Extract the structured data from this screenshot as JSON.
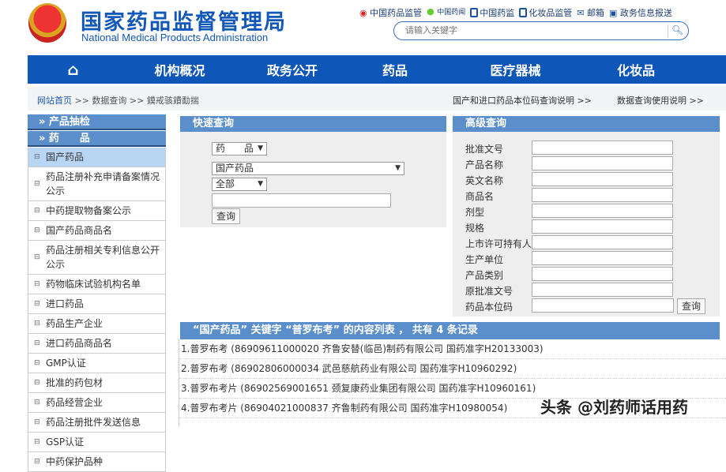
{
  "header": {
    "title_cn": "国家药品监督管理局",
    "title_en": "National Medical Products Administration",
    "links": [
      "中国药品监管",
      "中国药闻",
      "中国药监",
      "化妆品监管",
      "邮箱",
      "政务信息报送"
    ],
    "search_placeholder": "请输入关键字"
  },
  "nav": {
    "items": [
      "机构概况",
      "政务公开",
      "药品",
      "医疗器械",
      "化妆品"
    ]
  },
  "breadcrumb": {
    "home": "网站首页",
    "sep": ">>",
    "data": "数据查询",
    "current": "鏌戒骇鐨勫揣"
  },
  "help": {
    "code_help": "国产和进口药品本位码查询说明 >>",
    "usage_help": "数据查询使用说明 >>"
  },
  "sidebar": {
    "headers": [
      "» 产品抽检",
      "» 药　　品"
    ],
    "items": [
      "国产药品",
      "药品注册补充申请备案情况公示",
      "中药提取物备案公示",
      "国产药品商品名",
      "药品注册相关专利信息公开公示",
      "药物临床试验机构名单",
      "进口药品",
      "药品生产企业",
      "进口药品商品名",
      "GMP认证",
      "批准的药包材",
      "药品经营企业",
      "药品注册批件发送信息",
      "GSP认证",
      "中药保护品种"
    ]
  },
  "quick": {
    "title": "快速查询",
    "category": "药　　品",
    "database": "国产药品",
    "scope": "全部",
    "keyword": "",
    "button": "查询"
  },
  "advanced": {
    "title": "高级查询",
    "fields": [
      "批准文号",
      "产品名称",
      "英文名称",
      "商品名",
      "剂型",
      "规格",
      "上市许可持有人",
      "生产单位",
      "产品类别",
      "原批准文号",
      "药品本位码"
    ],
    "button": "查询"
  },
  "results": {
    "title": "“国产药品” 关键字 “普罗布考” 的内容列表 ， 共有 4 条记录",
    "rows": [
      "1.普罗布考 (86909611000020 齐鲁安替(临邑)制药有限公司 国药准字H20133003)",
      "2.普罗布考 (86902806000034 武邑慈航药业有限公司 国药准字H10960292)",
      "3.普罗布考片 (86902569001651 颈复康药业集团有限公司 国药准字H10960161)",
      "4.普罗布考片 (86904021000837 齐鲁制药有限公司 国药准字H10980054)"
    ]
  },
  "watermark": "头条 @刘药师话用药"
}
